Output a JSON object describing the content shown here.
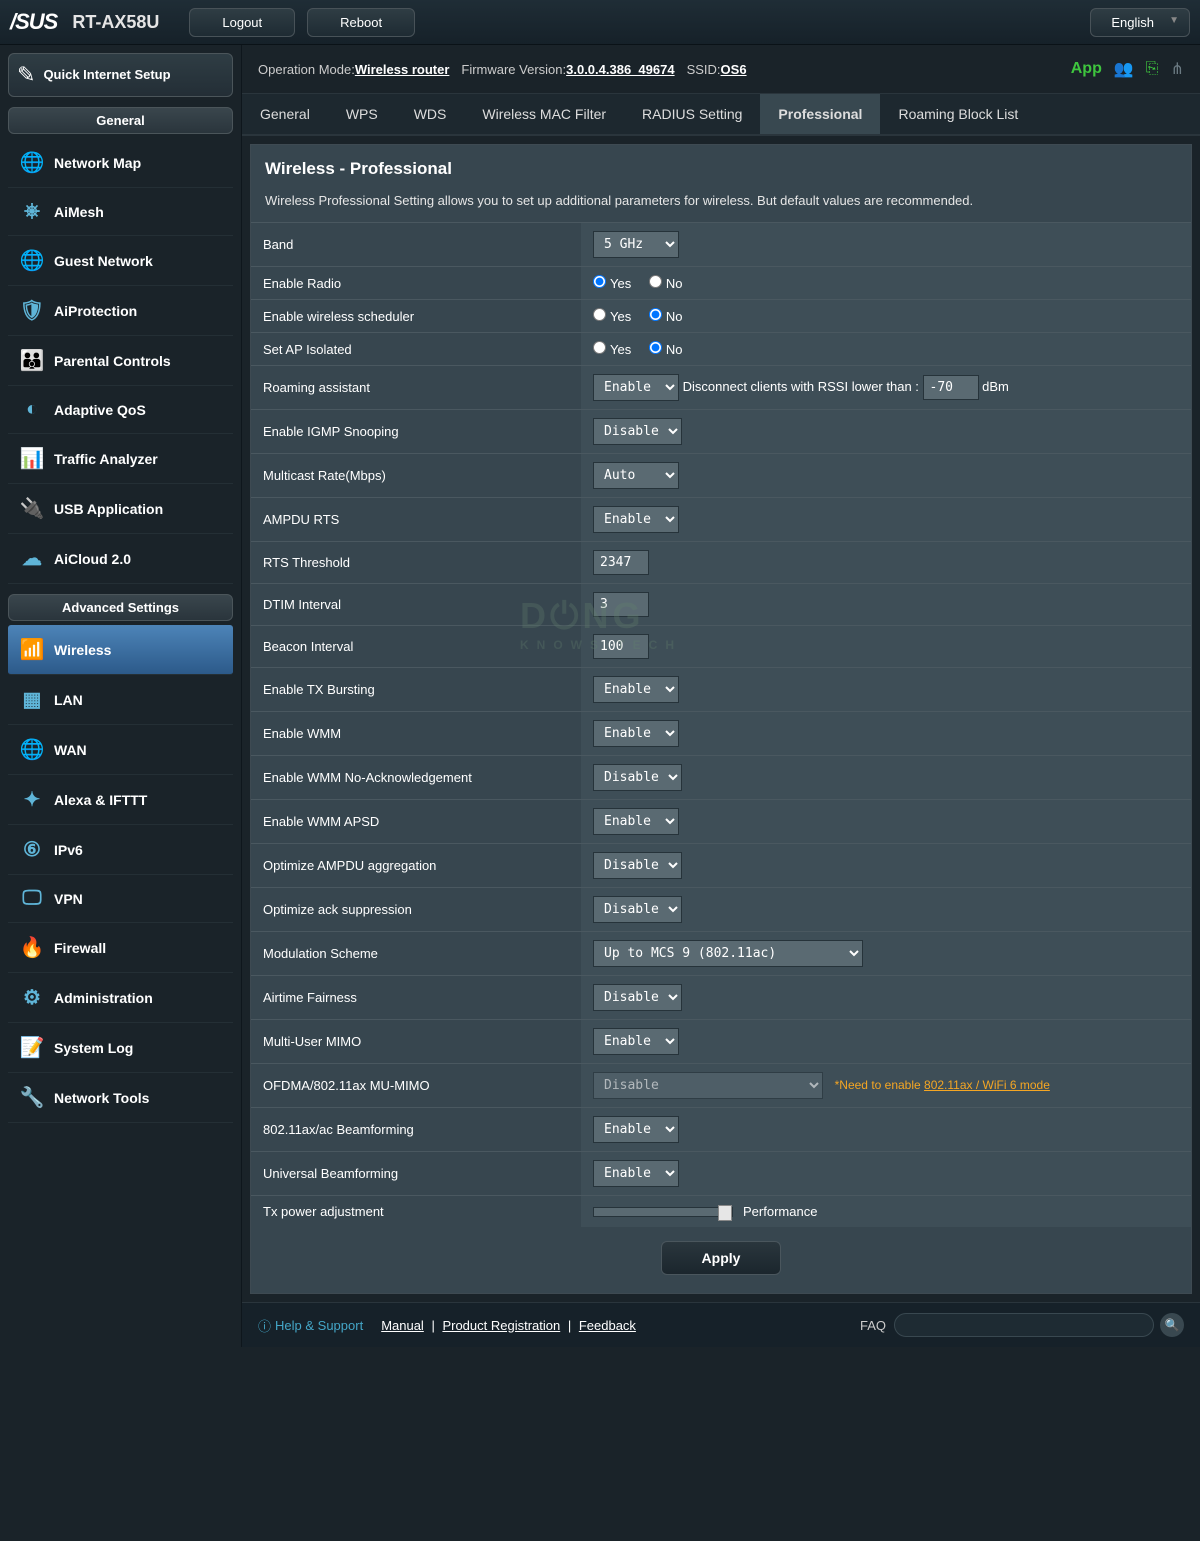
{
  "header": {
    "brand": "/SUS",
    "model": "RT-AX58U",
    "logout": "Logout",
    "reboot": "Reboot",
    "language": "English"
  },
  "sidebar": {
    "qis": "Quick Internet Setup",
    "general_head": "General",
    "general": [
      "Network Map",
      "AiMesh",
      "Guest Network",
      "AiProtection",
      "Parental Controls",
      "Adaptive QoS",
      "Traffic Analyzer",
      "USB Application",
      "AiCloud 2.0"
    ],
    "advanced_head": "Advanced Settings",
    "advanced": [
      "Wireless",
      "LAN",
      "WAN",
      "Alexa & IFTTT",
      "IPv6",
      "VPN",
      "Firewall",
      "Administration",
      "System Log",
      "Network Tools"
    ]
  },
  "meta": {
    "op_mode_lbl": "Operation Mode: ",
    "op_mode": "Wireless router",
    "fw_lbl": " Firmware Version: ",
    "fw": "3.0.0.4.386_49674",
    "ssid_lbl": " SSID: ",
    "ssid": "OS6",
    "app": "App"
  },
  "tabs": [
    "General",
    "WPS",
    "WDS",
    "Wireless MAC Filter",
    "RADIUS Setting",
    "Professional",
    "Roaming Block List"
  ],
  "active_tab": 5,
  "panel": {
    "title": "Wireless - Professional",
    "desc": "Wireless Professional Setting allows you to set up additional parameters for wireless. But default values are recommended."
  },
  "form": {
    "band": {
      "label": "Band",
      "value": "5 GHz"
    },
    "enable_radio": {
      "label": "Enable Radio",
      "value": "Yes",
      "opts": [
        "Yes",
        "No"
      ]
    },
    "scheduler": {
      "label": "Enable wireless scheduler",
      "value": "No",
      "opts": [
        "Yes",
        "No"
      ]
    },
    "ap_isolated": {
      "label": "Set AP Isolated",
      "value": "No",
      "opts": [
        "Yes",
        "No"
      ]
    },
    "roaming": {
      "label": "Roaming assistant",
      "value": "Enable",
      "desc": "Disconnect clients with RSSI lower than :",
      "rssi": "-70",
      "unit": "dBm"
    },
    "igmp": {
      "label": "Enable IGMP Snooping",
      "value": "Disable"
    },
    "multicast": {
      "label": "Multicast Rate(Mbps)",
      "value": "Auto"
    },
    "ampdu_rts": {
      "label": "AMPDU RTS",
      "value": "Enable"
    },
    "rts": {
      "label": "RTS Threshold",
      "value": "2347"
    },
    "dtim": {
      "label": "DTIM Interval",
      "value": "3"
    },
    "beacon": {
      "label": "Beacon Interval",
      "value": "100"
    },
    "tx_burst": {
      "label": "Enable TX Bursting",
      "value": "Enable"
    },
    "wmm": {
      "label": "Enable WMM",
      "value": "Enable"
    },
    "wmm_noack": {
      "label": "Enable WMM No-Acknowledgement",
      "value": "Disable"
    },
    "wmm_apsd": {
      "label": "Enable WMM APSD",
      "value": "Enable"
    },
    "opt_ampdu": {
      "label": "Optimize AMPDU aggregation",
      "value": "Disable"
    },
    "opt_ack": {
      "label": "Optimize ack suppression",
      "value": "Disable"
    },
    "modulation": {
      "label": "Modulation Scheme",
      "value": "Up to MCS 9 (802.11ac)"
    },
    "airtime": {
      "label": "Airtime Fairness",
      "value": "Disable"
    },
    "mumimo": {
      "label": "Multi-User MIMO",
      "value": "Enable"
    },
    "ofdma": {
      "label": "OFDMA/802.11ax MU-MIMO",
      "value": "Disable",
      "note": "*Need to enable ",
      "note_link": "802.11ax / WiFi 6 mode"
    },
    "beamforming_ax": {
      "label": "802.11ax/ac Beamforming",
      "value": "Enable"
    },
    "beamforming_u": {
      "label": "Universal Beamforming",
      "value": "Enable"
    },
    "tx_power": {
      "label": "Tx power adjustment",
      "value": "Performance"
    },
    "apply": "Apply"
  },
  "footer": {
    "help": "Help & Support",
    "links": [
      "Manual",
      "Product Registration",
      "Feedback"
    ],
    "faq": "FAQ"
  }
}
